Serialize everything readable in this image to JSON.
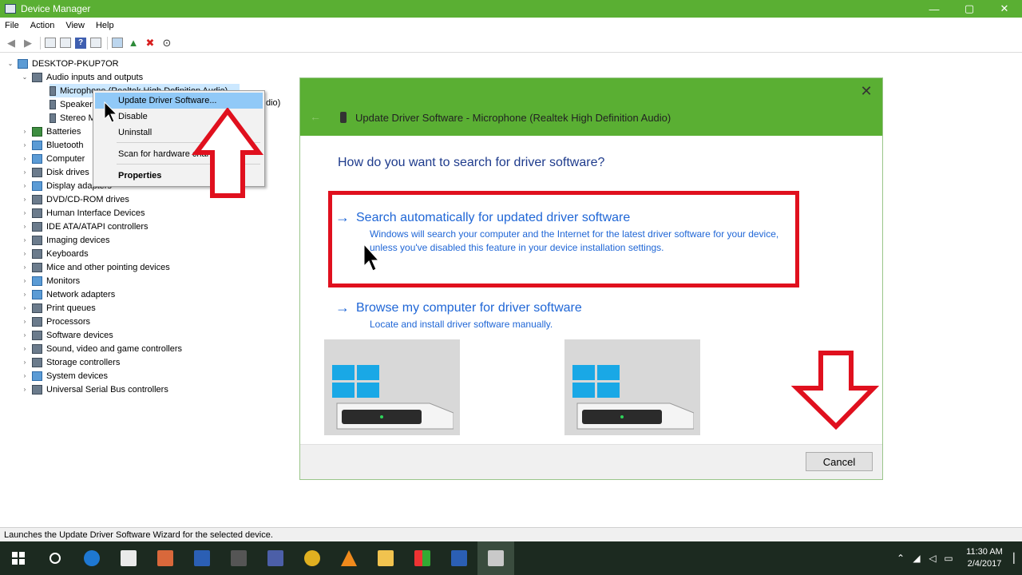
{
  "window": {
    "title": "Device Manager",
    "controls": [
      "—",
      "▢",
      "✕"
    ]
  },
  "menu": [
    "File",
    "Action",
    "View",
    "Help"
  ],
  "tree": {
    "root": "DESKTOP-PKUP7OR",
    "audio_group": "Audio inputs and outputs",
    "audio_children": [
      "Microphone (Realtek High Definition Audio)",
      "Speakers (Realtek High Definition Audio)",
      "Stereo Mix (Realtek High Definition Audio)"
    ],
    "categories": [
      "Batteries",
      "Bluetooth",
      "Computer",
      "Disk drives",
      "Display adapters",
      "DVD/CD-ROM drives",
      "Human Interface Devices",
      "IDE ATA/ATAPI controllers",
      "Imaging devices",
      "Keyboards",
      "Mice and other pointing devices",
      "Monitors",
      "Network adapters",
      "Print queues",
      "Processors",
      "Software devices",
      "Sound, video and game controllers",
      "Storage controllers",
      "System devices",
      "Universal Serial Bus controllers"
    ],
    "speaker_tail": "dio)"
  },
  "context_menu": {
    "update": "Update Driver Software...",
    "disable": "Disable",
    "uninstall": "Uninstall",
    "scan": "Scan for hardware changes",
    "properties": "Properties"
  },
  "dialog": {
    "title": "Update Driver Software - Microphone (Realtek High Definition Audio)",
    "question": "How do you want to search for driver software?",
    "option_auto_title": "Search automatically for updated driver software",
    "option_auto_desc": "Windows will search your computer and the Internet for the latest driver software for your device, unless you've disabled this feature in your device installation settings.",
    "option_browse_title": "Browse my computer for driver software",
    "option_browse_desc": "Locate and install driver software manually.",
    "cancel": "Cancel",
    "close": "✕"
  },
  "status_bar": "Launches the Update Driver Software Wizard for the selected device.",
  "taskbar": {
    "time": "11:30 AM",
    "date": "2/4/2017"
  },
  "colors": {
    "accent_green": "#5aaf33",
    "link_blue": "#1f66d6",
    "highlight_red": "#e0101e"
  }
}
